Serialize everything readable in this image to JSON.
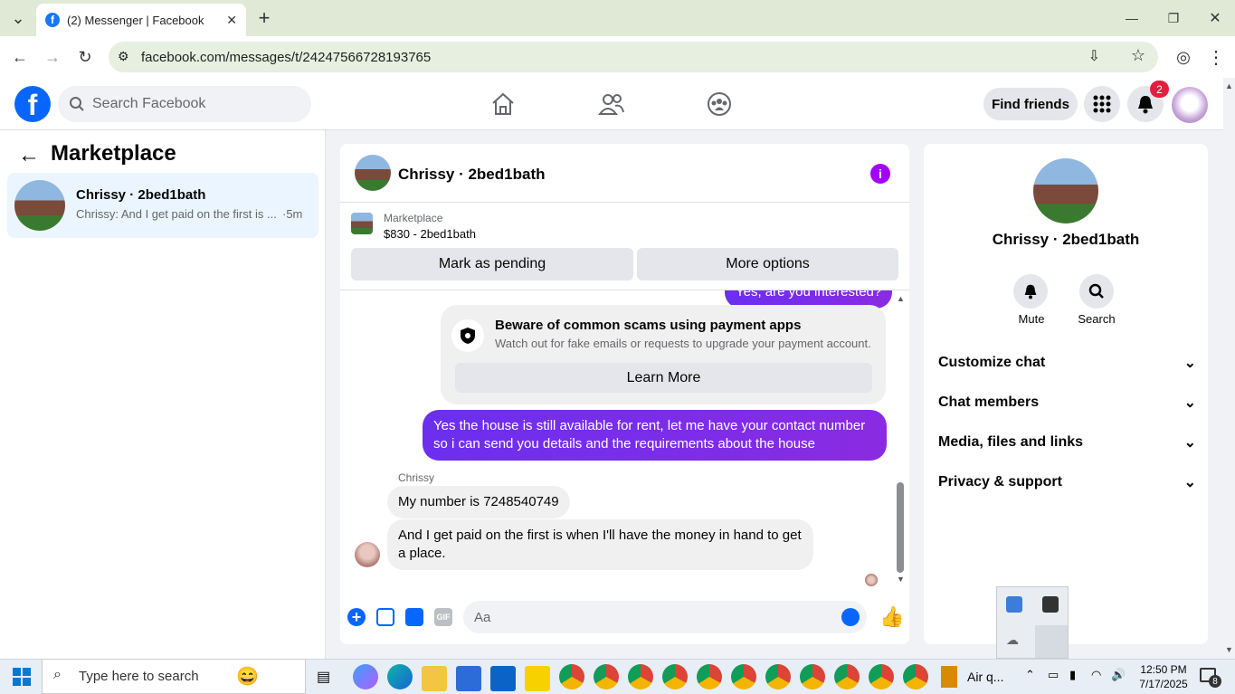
{
  "browser": {
    "tab_title": "(2) Messenger | Facebook",
    "url": "facebook.com/messages/t/24247566728193765"
  },
  "header": {
    "search_placeholder": "Search Facebook",
    "find_friends": "Find friends",
    "notification_count": "2"
  },
  "left": {
    "title": "Marketplace",
    "conversation": {
      "name": "Chrissy · 2bed1bath",
      "preview": "Chrissy: And I get paid on the first is ...",
      "time": "·5m"
    }
  },
  "chat": {
    "title": "Chrissy · 2bed1bath",
    "listing_source": "Marketplace",
    "listing_title": "$830 - 2bed1bath",
    "mark_pending": "Mark as pending",
    "more_options": "More options",
    "partial_message": "Yes, are you interested?",
    "scam_title": "Beware of common scams using payment apps",
    "scam_body": "Watch out for fake emails or requests to upgrade your payment account.",
    "learn_more": "Learn More",
    "outgoing_message": "Yes the house is still available for rent, let me have your contact number so i can send you details and the requirements about the house",
    "sender_name": "Chrissy",
    "incoming_1": "My number is 7248540749",
    "incoming_2": "And I get paid on the first is when I'll have the money in hand to get a place.",
    "composer_placeholder": "Aa"
  },
  "right": {
    "name": "Chrissy · 2bed1bath",
    "mute": "Mute",
    "search": "Search",
    "sections": [
      "Customize chat",
      "Chat members",
      "Media, files and links",
      "Privacy & support"
    ]
  },
  "taskbar": {
    "search_placeholder": "Type here to search",
    "weather": "Air q...",
    "time": "12:50 PM",
    "date": "7/17/2025",
    "notification_count": "8"
  },
  "colors": {
    "fb_blue": "#0866ff",
    "messenger_purple": "#7a29f6",
    "selected_bg": "#ebf5ff"
  }
}
